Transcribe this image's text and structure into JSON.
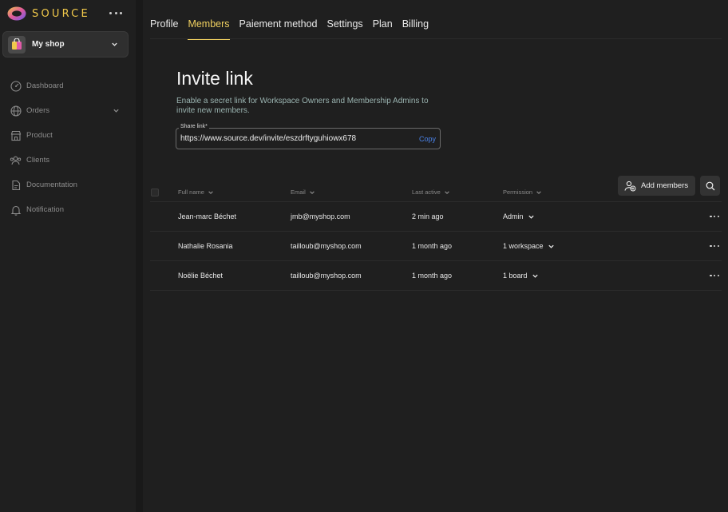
{
  "brand": {
    "name": "SOURCE"
  },
  "workspace": {
    "name": "My shop"
  },
  "sidebar": {
    "items": [
      {
        "label": "Dashboard",
        "icon": "dashboard-icon"
      },
      {
        "label": "Orders",
        "icon": "globe-icon",
        "expandable": true
      },
      {
        "label": "Product",
        "icon": "store-icon"
      },
      {
        "label": "Clients",
        "icon": "users-icon"
      },
      {
        "label": "Documentation",
        "icon": "document-icon"
      },
      {
        "label": "Notification",
        "icon": "bell-icon"
      }
    ]
  },
  "tabs": [
    {
      "label": "Profile",
      "active": false
    },
    {
      "label": "Members",
      "active": true
    },
    {
      "label": "Paiement method",
      "active": false
    },
    {
      "label": "Settings",
      "active": false
    },
    {
      "label": "Plan",
      "active": false
    },
    {
      "label": "Billing",
      "active": false
    }
  ],
  "invite": {
    "title": "Invite link",
    "description": "Enable a secret link for Workspace Owners and Membership Admins to invite new members.",
    "share_label": "Share link*",
    "share_value": "https://www.source.dev/invite/eszdrftyguhiowx678",
    "copy_label": "Copy"
  },
  "actions": {
    "add_members": "Add members"
  },
  "table": {
    "columns": [
      "Full name",
      "Email",
      "Last active",
      "Permission"
    ],
    "rows": [
      {
        "name": "Jean-marc Béchet",
        "email": "jmb@myshop.com",
        "last_active": "2 min ago",
        "permission": "Admin"
      },
      {
        "name": "Nathalie Rosania",
        "email": "tailloub@myshop.com",
        "last_active": "1 month ago",
        "permission": "1 workspace"
      },
      {
        "name": "Noëlie Béchet",
        "email": "tailloub@myshop.com",
        "last_active": "1 month ago",
        "permission": "1 board"
      }
    ]
  },
  "colors": {
    "accent": "#f0d060",
    "link": "#4a82e8",
    "background": "#1f1f1f"
  }
}
